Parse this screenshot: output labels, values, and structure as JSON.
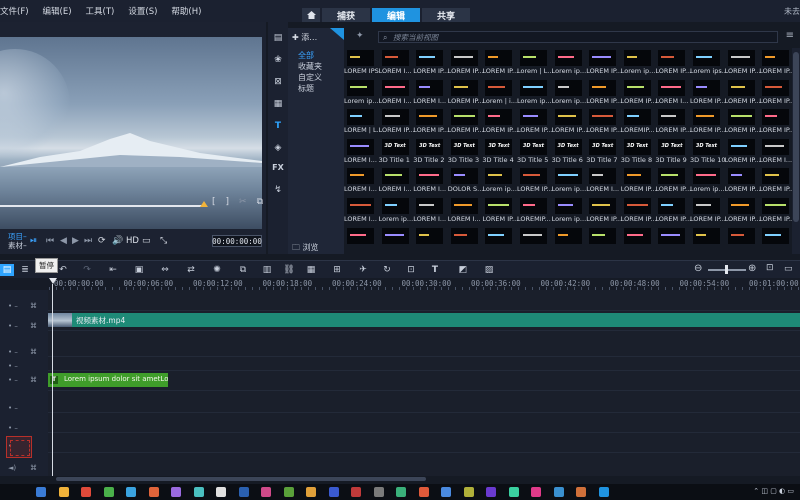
{
  "menu": {
    "items": [
      "文件(F)",
      "编辑(E)",
      "工具(T)",
      "设置(S)",
      "帮助(H)"
    ]
  },
  "mode_tabs": [
    {
      "label": "捕获",
      "active": false
    },
    {
      "label": "编辑",
      "active": true
    },
    {
      "label": "共享",
      "active": false
    }
  ],
  "top_right_text": "未去",
  "preview": {
    "project_label": "项目",
    "clip_label": "素材",
    "hd_label": "HD",
    "timecode": "00:00:00:00"
  },
  "library": {
    "add_label": "添",
    "categories": [
      {
        "label": "全部",
        "selected": true
      },
      {
        "label": "收藏夹",
        "selected": false
      },
      {
        "label": "自定义",
        "selected": false
      },
      {
        "label": "标题",
        "selected": false
      }
    ],
    "browse_label": "浏览",
    "search_placeholder": "搜索当前视图",
    "rows": [
      [
        "LOREM IPS",
        "LOREM I...",
        "LOREM IP...",
        "LOREM IP...",
        "LOREM IP...",
        "Lorem | L...",
        "Lorem ip...",
        "LOREM IP...",
        "Lorem ip...",
        "LOREM IP...",
        "Lorem ips...",
        "LOREM IP...",
        "LOREM IP..."
      ],
      [
        "Lorem ip...",
        "LOREM I...",
        "LOREM I...",
        "LOREM IP...",
        "Lorem | i...",
        "Lorem ip...",
        "Lorem ip...",
        "LOREM IP...",
        "LOREM IP...",
        "LOREM I...",
        "LOREM IP...",
        "LOREM IP...",
        "LOREM IP..."
      ],
      [
        "LOREM | L...",
        "LOREM IP...",
        "LOREM IP...",
        "LOREM IP...",
        "LOREM IP...",
        "LOREM IP...",
        "LOREM IP...",
        "LOREM IP...",
        "LOREMIP...",
        "LOREM IP...",
        "LOREM IP...",
        "LOREM IP...",
        "LOREM IP..."
      ],
      [
        "LOREM I...",
        "3D Title 1",
        "3D Title 2",
        "3D Title 3",
        "3D Title 4",
        "3D Title 5",
        "3D Title 6",
        "3D Title 7",
        "3D Title 8",
        "3D Title 9",
        "3D Title 10",
        "LOREM IP...",
        "LOREM I..."
      ],
      [
        "LOREM I...",
        "LOREM I...",
        "LOREM I...",
        "DOLOR S...",
        "Lorem ip...",
        "LOREM IP...",
        "Lorem ip...",
        "LOREM I...",
        "LOREM IP...",
        "LOREM IP...",
        "Lorem ip...",
        "LOREM IP...",
        "LOREM IP..."
      ],
      [
        "LOREM I...",
        "Lorem ip...",
        "LOREM I...",
        "LOREM I...",
        "LOREM IP...",
        "LOREMIP...",
        "Lorem ip...",
        "LOREM IP...",
        "LOREM IP...",
        "LOREM IP...",
        "LOREM IP...",
        "LOREM IP...",
        "LOREM IP..."
      ],
      [
        "",
        "",
        "",
        "",
        "",
        "",
        "",
        "",
        "",
        "",
        "",
        "",
        ""
      ]
    ]
  },
  "timeline": {
    "pause_tooltip": "暂停",
    "ruler_labels": [
      "00:00:00:00",
      "00:00:06:00",
      "00:00:12:00",
      "00:00:18:00",
      "00:00:24:00",
      "00:00:30:00",
      "00:00:36:00",
      "00:00:42:00",
      "00:00:48:00",
      "00:00:54:00",
      "00:01:00:00"
    ],
    "video_clip_name": "视频素材.mp4",
    "title_clip_text": "Lorem ipsum dolor sit ametLorem ipsu",
    "title_clip_badge": "T"
  }
}
